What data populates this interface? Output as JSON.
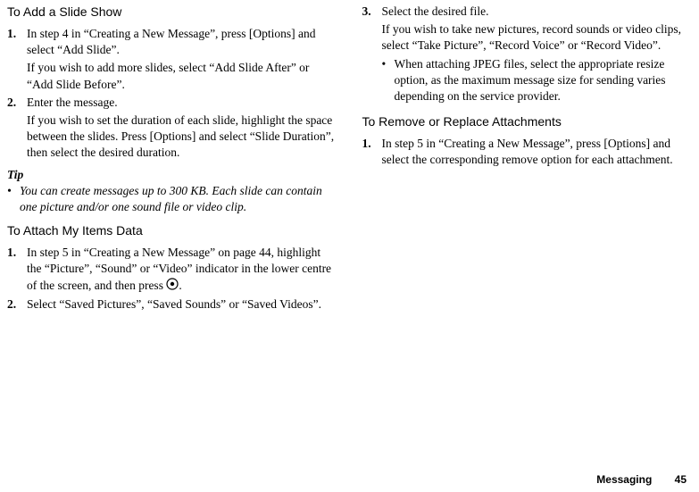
{
  "left": {
    "heading1": "To Add a Slide Show",
    "i1_num": "1.",
    "i1_text": "In step 4 in “Creating a New Message”, press [Options] and select “Add Slide”.",
    "i1_para": "If you wish to add more slides, select “Add Slide After” or “Add Slide Before”.",
    "i2_num": "2.",
    "i2_text": "Enter the message.",
    "i2_para": "If you wish to set the duration of each slide, highlight the space between the slides. Press [Options] and select “Slide Duration”, then select the desired duration.",
    "tip_label": "Tip",
    "tip_bullet": "•",
    "tip_text": "You can create messages up to 300 KB. Each slide can contain one picture and/or one sound file or video clip.",
    "heading2": "To Attach My Items Data",
    "a1_num": "1.",
    "a1_text_before": "In step 5 in “Creating a New Message” on page 44, highlight the “Picture”, “Sound” or “Video” indicator in the lower centre of the screen, and then press ",
    "a1_text_after": ".",
    "a2_num": "2.",
    "a2_text": "Select “Saved Pictures”, “Saved Sounds” or “Saved Videos”."
  },
  "right": {
    "i3_num": "3.",
    "i3_text": "Select the desired file.",
    "i3_para": "If you wish to take new pictures, record sounds or video clips, select “Take Picture”, “Record Voice” or “Record Video”.",
    "bul_marker": "•",
    "bul_text": "When attaching JPEG files, select the appropriate resize option, as the maximum message size for sending varies depending on the service provider.",
    "heading3": "To Remove or Replace Attachments",
    "r1_num": "1.",
    "r1_text": "In step 5 in “Creating a New Message”, press [Options] and select the corresponding remove option for each attachment."
  },
  "footer": {
    "section": "Messaging",
    "page": "45"
  }
}
